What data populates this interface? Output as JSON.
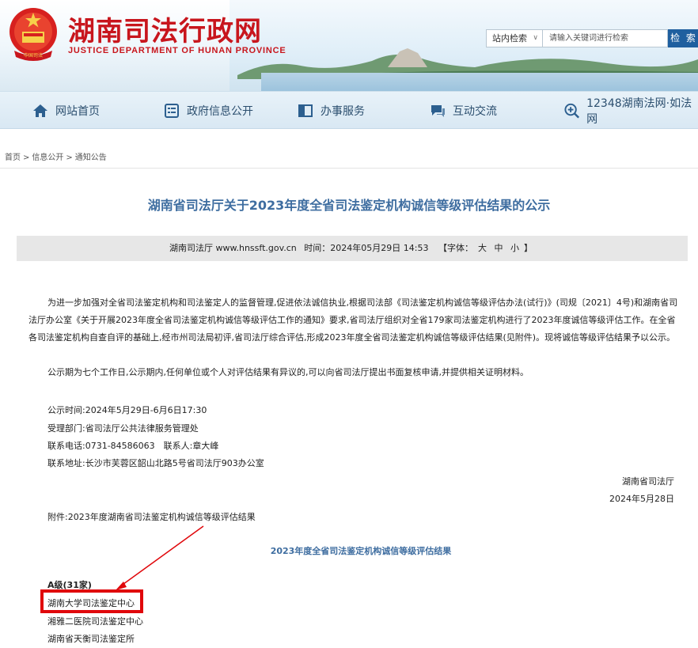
{
  "header": {
    "title": "湖南司法行政网",
    "subtitle": "JUSTICE DEPARTMENT OF HUNAN PROVINCE",
    "emblem_text": "中国司法",
    "search": {
      "scope": "站内检索",
      "placeholder": "请输入关键词进行检索",
      "button": "检 索"
    }
  },
  "nav": {
    "items": [
      {
        "label": "网站首页",
        "icon": "home-icon"
      },
      {
        "label": "政府信息公开",
        "icon": "info-list-icon"
      },
      {
        "label": "办事服务",
        "icon": "service-window-icon"
      },
      {
        "label": "互动交流",
        "icon": "chat-icon"
      },
      {
        "label": "12348湖南法网·如法网",
        "icon": "search-plus-icon"
      }
    ]
  },
  "breadcrumb": [
    "首页",
    "信息公开",
    "通知公告"
  ],
  "article": {
    "title": "湖南省司法厅关于2023年度全省司法鉴定机构诚信等级评估结果的公示",
    "meta": {
      "source": "湖南司法厅 www.hnssft.gov.cn",
      "time_label": "时间：2024年05月29日 14:53",
      "font_label": "【字体：",
      "font_large": "大",
      "font_medium": "中",
      "font_small": "小",
      "font_close": "】"
    },
    "paragraph1": "为进一步加强对全省司法鉴定机构和司法鉴定人的监督管理,促进依法诚信执业,根据司法部《司法鉴定机构诚信等级评估办法(试行)》(司规〔2021〕4号)和湖南省司法厅办公室《关于开展2023年度全省司法鉴定机构诚信等级评估工作的通知》要求,省司法厅组织对全省179家司法鉴定机构进行了2023年度诚信等级评估工作。在全省各司法鉴定机构自查自评的基础上,经市州司法局初评,省司法厅综合评估,形成2023年度全省司法鉴定机构诚信等级评估结果(见附件)。现将诚信等级评估结果予以公示。",
    "paragraph2": "公示期为七个工作日,公示期内,任何单位或个人对评估结果有异议的,可以向省司法厅提出书面复核申请,并提供相关证明材料。",
    "publicity_time": "公示时间:2024年5月29日-6月6日17:30",
    "department": "受理部门:省司法厅公共法律服务管理处",
    "phone": "联系电话:0731-84586063　联系人:章大峰",
    "address": "联系地址:长沙市芙蓉区韶山北路5号省司法厅903办公室",
    "signer": "湖南省司法厅",
    "date": "2024年5月28日",
    "attachment": "附件:2023年度湖南省司法鉴定机构诚信等级评估结果"
  },
  "results": {
    "table_title": "2023年度全省司法鉴定机构诚信等级评估结果",
    "grade_a_heading": "A级(31家)",
    "organizations": [
      "湖南大学司法鉴定中心",
      "湘雅二医院司法鉴定中心",
      "湖南省天衡司法鉴定所"
    ]
  },
  "annotation": {
    "highlight_color": "#e0070b"
  }
}
